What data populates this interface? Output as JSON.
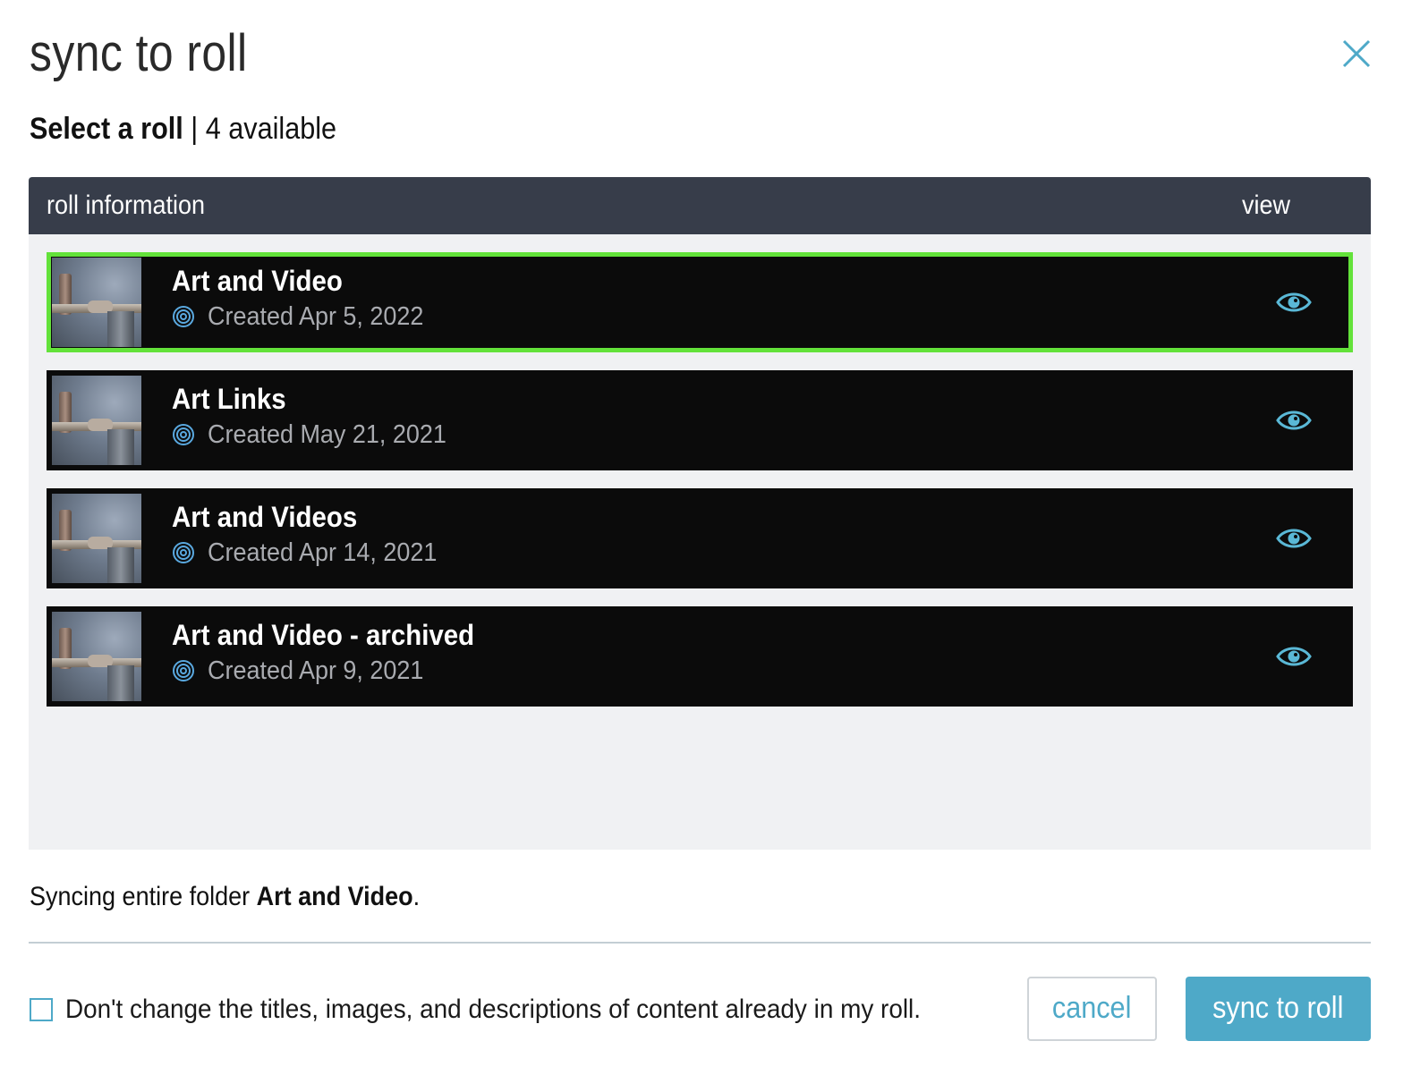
{
  "dialog": {
    "title": "sync to roll",
    "close_icon": "close-icon"
  },
  "subheading": {
    "label": "Select a roll",
    "separator": " | ",
    "count_text": "4 available"
  },
  "table": {
    "columns": {
      "info": "roll information",
      "view": "view"
    },
    "rows": [
      {
        "title": "Art and Video",
        "created": "Created Apr 5, 2022",
        "selected": true
      },
      {
        "title": "Art Links",
        "created": "Created May 21, 2021",
        "selected": false
      },
      {
        "title": "Art and Videos",
        "created": "Created Apr 14, 2021",
        "selected": false
      },
      {
        "title": "Art and Video - archived",
        "created": "Created Apr 9, 2021",
        "selected": false
      }
    ]
  },
  "syncing_message": {
    "prefix": "Syncing entire folder ",
    "folder": "Art and Video",
    "suffix": "."
  },
  "options": {
    "preserve_content_label": "Don't change the titles, images, and descriptions of content already in my roll.",
    "preserve_content_checked": false
  },
  "buttons": {
    "cancel": "cancel",
    "submit": "sync to roll"
  },
  "colors": {
    "accent": "#4ea9c8",
    "selected_border": "#63e23a",
    "header_bg": "#373d4a",
    "row_bg": "#0b0b0b"
  }
}
